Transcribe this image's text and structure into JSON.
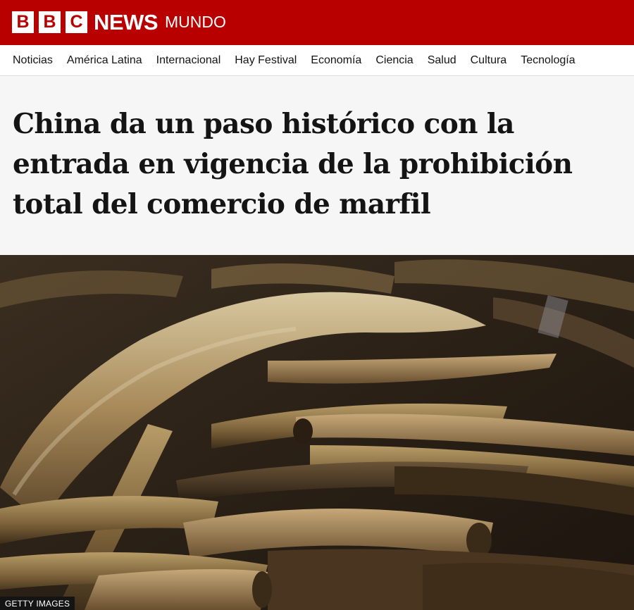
{
  "brand": {
    "letters": [
      "B",
      "B",
      "C"
    ],
    "news": "NEWS",
    "edition": "MUNDO",
    "color": "#b80000"
  },
  "nav": {
    "items": [
      {
        "label": "Noticias"
      },
      {
        "label": "América Latina"
      },
      {
        "label": "Internacional"
      },
      {
        "label": "Hay Festival"
      },
      {
        "label": "Economía"
      },
      {
        "label": "Ciencia"
      },
      {
        "label": "Salud"
      },
      {
        "label": "Cultura"
      },
      {
        "label": "Tecnología"
      }
    ]
  },
  "article": {
    "headline": "China da un paso histórico con la entrada en vigencia de la prohibición total del comercio de marfil",
    "image_credit": "GETTY IMAGES"
  }
}
